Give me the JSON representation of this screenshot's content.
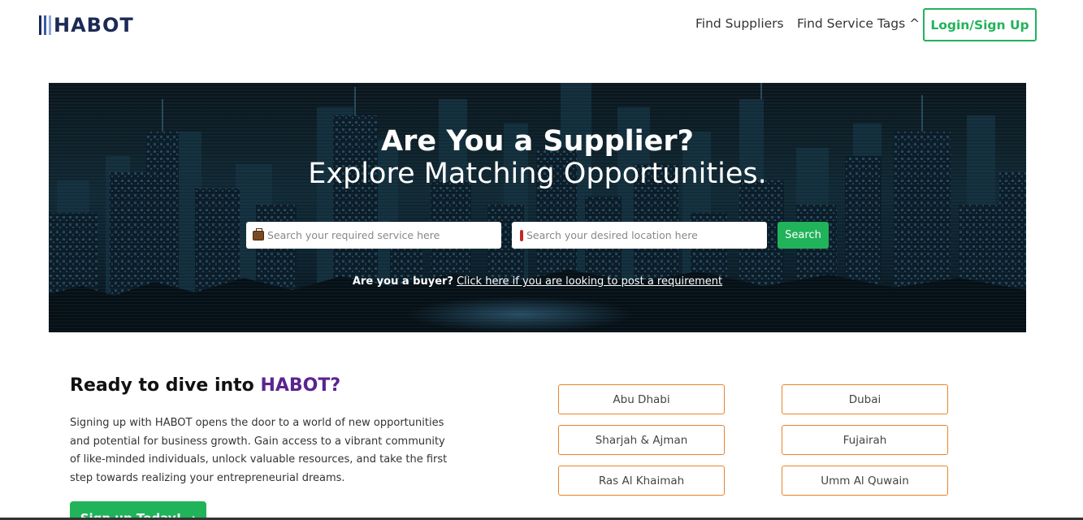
{
  "header": {
    "logo_text": "HABOT",
    "logo_colors": [
      "#1b2a55",
      "#3a5aa8",
      "#8fa6d8"
    ],
    "nav": {
      "find_suppliers": "Find Suppliers",
      "find_service_tags": "Find Service Tags ^"
    },
    "login_label": "Login/Sign Up"
  },
  "hero": {
    "title": "Are You a Supplier?",
    "subtitle": "Explore Matching Opportunities.",
    "service_placeholder": "Search your required service here",
    "service_icon": "briefcase-icon",
    "location_placeholder": "Search your desired location here",
    "location_icon": "exclamation-pin-icon",
    "search_label": "Search",
    "buyer_question": "Are you a buyer?",
    "buyer_link": "Click here if you are looking to post a requirement"
  },
  "intro": {
    "title_prefix": "Ready to dive into ",
    "title_brand": "HABOT?",
    "text": "Signing up with HABOT opens the door to a world of new opportunities and potential for business growth. Gain access to a vibrant community of like-minded individuals, unlock valuable resources, and take the first step towards realizing your entrepreneurial dreams.",
    "signup_label": "Sign up Today! →"
  },
  "cities": [
    "Abu Dhabi",
    "Dubai",
    "Sharjah & Ajman",
    "Fujairah",
    "Ras Al Khaimah",
    "Umm Al Quwain"
  ],
  "colors": {
    "accent_green": "#21b35a",
    "brand_purple": "#5a2490",
    "city_border": "#e8832a"
  }
}
